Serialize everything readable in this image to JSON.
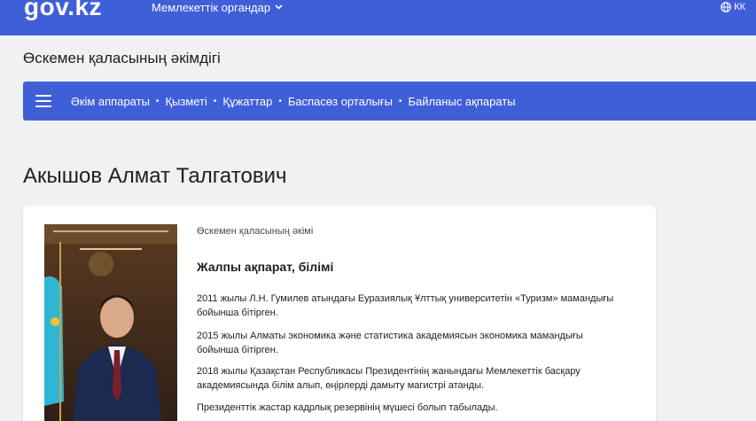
{
  "header": {
    "logo": "gov.kz",
    "orgs_menu_label": "Мемлекеттік органдар",
    "language": "КК"
  },
  "org": {
    "title": "Өскемен қаласының әкімдігі"
  },
  "nav": {
    "items": [
      {
        "label": "Әкім аппараты"
      },
      {
        "label": "Қызметі"
      },
      {
        "label": "Құжаттар"
      },
      {
        "label": "Баспасөз орталығы"
      },
      {
        "label": "Байланыс ақпараты"
      }
    ]
  },
  "person": {
    "name": "Акышов Алмат Талгатович",
    "position": "Өскемен қаласының әкімі",
    "section_title": "Жалпы ақпарат, білімі",
    "bio": [
      "2011 жылы Л.Н. Гумилев атындағы Еуразиялық Ұлттық университетін «Туризм» мамандығы бойынша бітірген.",
      "2015 жылы Алматы экономика және статистика академиясын экономика мамандығы бойынша бітірген.",
      "2018 жылы Қазақстан Республикасы Президентінің жанындағы Мемлекеттік басқару академиясында білім алып, өңірлерді дамыту магистрі атанды.",
      "Президенттік жастар кадрлық резервінің мүшесі болып табылады."
    ]
  },
  "colors": {
    "brand_blue": "#3f5fd8",
    "page_bg": "#f1f1f3"
  }
}
